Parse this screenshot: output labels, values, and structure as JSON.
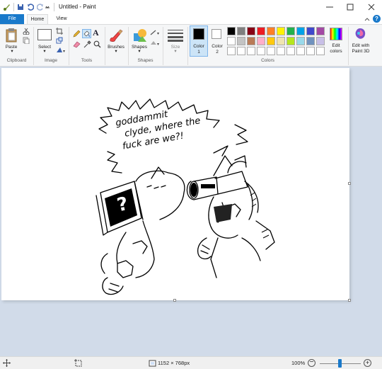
{
  "window": {
    "title": "Untitled - Paint"
  },
  "tabs": {
    "file": "File",
    "home": "Home",
    "view": "View"
  },
  "ribbon": {
    "paste_label": "Paste",
    "select_label": "Select",
    "brushes_label": "Brushes",
    "shapes_label": "Shapes",
    "size_label": "Size",
    "color1_label": "Color\n1",
    "color2_label": "Color\n2",
    "edit_colors_label": "Edit\ncolors",
    "edit_paint3d_label": "Edit with\nPaint 3D",
    "groups": {
      "clipboard": "Clipboard",
      "image": "Image",
      "tools": "Tools",
      "shapes": "Shapes",
      "colors": "Colors"
    },
    "palette_row1": [
      "#000000",
      "#7f7f7f",
      "#880015",
      "#ed1c24",
      "#ff7f27",
      "#fff200",
      "#22b14c",
      "#00a2e8",
      "#3f48cc",
      "#a349a4"
    ],
    "palette_row2": [
      "#ffffff",
      "#c3c3c3",
      "#b97a57",
      "#ffaec9",
      "#ffc90e",
      "#efe4b0",
      "#b5e61d",
      "#99d9ea",
      "#7092be",
      "#c8bfe7"
    ],
    "color1": "#000000",
    "color2": "#ffffff"
  },
  "drawing": {
    "speech_line1": "goddammit",
    "speech_line2": "clyde, where the",
    "speech_line3": "fuck are we?!",
    "book_mark": "?"
  },
  "status": {
    "dimensions": "1152 × 768px",
    "zoom": "100%"
  }
}
